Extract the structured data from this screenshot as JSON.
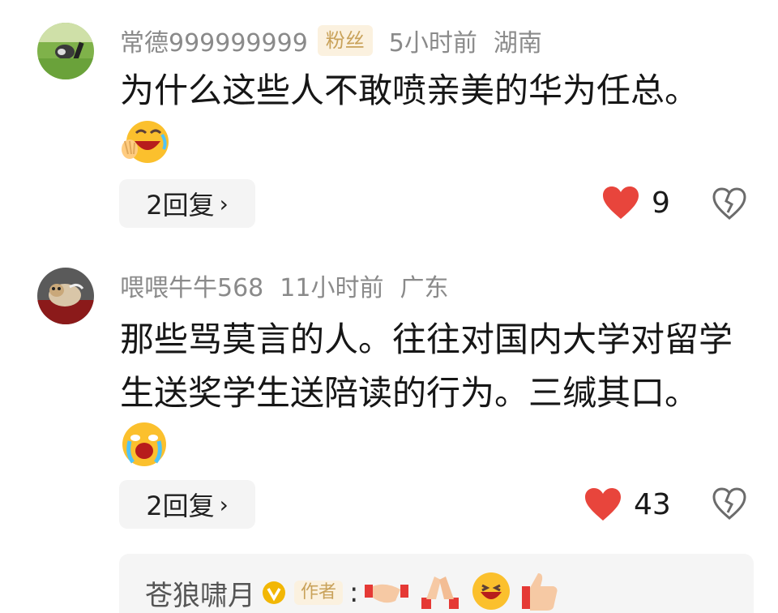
{
  "comments": [
    {
      "username": "常德999999999",
      "badge": "粉丝",
      "time": "5小时前",
      "location": "湖南",
      "text": "为什么这些人不敢喷亲美的华为任总。",
      "emojis": [
        "laughing-crying-emoji"
      ],
      "reply_label": "2回复",
      "reply_chevron": "›",
      "likes": "9"
    },
    {
      "username": "喂喂牛牛568",
      "time": "11小时前",
      "location": "广东",
      "text": "那些骂莫言的人。往往对国内大学对留学生送奖学生送陪读的行为。三缄其口。",
      "emojis": [
        "crying-emoji"
      ],
      "reply_label": "2回复",
      "reply_chevron": "›",
      "likes": "43"
    }
  ],
  "author_reply": {
    "name": "苍狼啸月",
    "tag": "作者",
    "colon": ":",
    "emojis": [
      "handshake-emoji",
      "clapping-emoji",
      "grinning-emoji",
      "thumbs-up-emoji"
    ]
  },
  "colors": {
    "like_red": "#e8453c",
    "badge_gold": "#c9a25a",
    "badge_bg": "#fbf1df",
    "muted": "#8a8a8a"
  }
}
